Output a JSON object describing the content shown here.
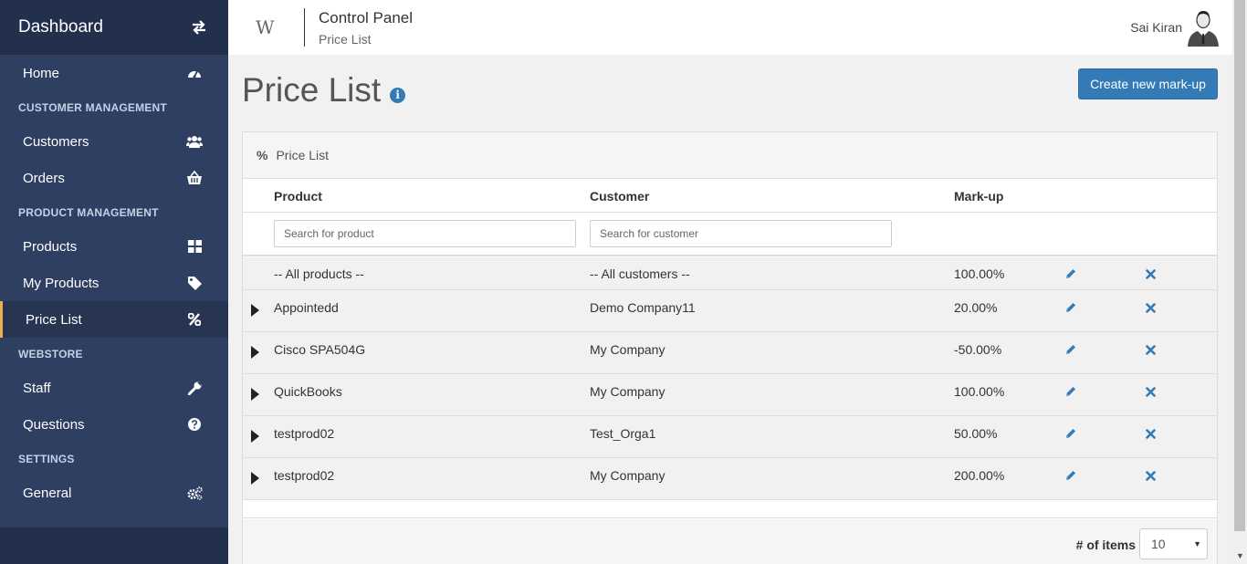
{
  "sidebar": {
    "title": "Dashboard",
    "items": [
      {
        "type": "item",
        "label": "Home",
        "icon": "dashboard-icon"
      },
      {
        "type": "section",
        "label": "CUSTOMER MANAGEMENT"
      },
      {
        "type": "item",
        "label": "Customers",
        "icon": "users-icon"
      },
      {
        "type": "item",
        "label": "Orders",
        "icon": "basket-icon"
      },
      {
        "type": "section",
        "label": "PRODUCT MANAGEMENT"
      },
      {
        "type": "item",
        "label": "Products",
        "icon": "grid-icon"
      },
      {
        "type": "item",
        "label": "My Products",
        "icon": "tag-icon"
      },
      {
        "type": "item",
        "label": "Price List",
        "icon": "percent-icon",
        "active": true
      },
      {
        "type": "section",
        "label": "WEBSTORE"
      },
      {
        "type": "item",
        "label": "Staff",
        "icon": "wrench-icon"
      },
      {
        "type": "item",
        "label": "Questions",
        "icon": "question-icon"
      },
      {
        "type": "section",
        "label": "SETTINGS"
      },
      {
        "type": "item",
        "label": "General",
        "icon": "cogs-icon"
      }
    ]
  },
  "topbar": {
    "logo": "W",
    "title": "Control Panel",
    "subtitle": "Price List",
    "user_name": "Sai Kiran"
  },
  "main": {
    "page_title": "Price List",
    "create_button": "Create new mark-up",
    "panel_title": "Price List",
    "columns": {
      "product": "Product",
      "customer": "Customer",
      "markup": "Mark-up"
    },
    "search_product_placeholder": "Search for product",
    "search_customer_placeholder": "Search for customer",
    "all_row": {
      "product": "-- All products --",
      "customer": "-- All customers --",
      "markup": "100.00%"
    },
    "rows": [
      {
        "product": "Appointedd",
        "customer": "Demo Company11",
        "markup": "20.00%"
      },
      {
        "product": "Cisco SPA504G",
        "customer": "My Company",
        "markup": "-50.00%"
      },
      {
        "product": "QuickBooks",
        "customer": "My Company",
        "markup": "100.00%"
      },
      {
        "product": "testprod02",
        "customer": "Test_Orga1",
        "markup": "50.00%"
      },
      {
        "product": "testprod02",
        "customer": "My Company",
        "markup": "200.00%"
      }
    ],
    "items_label": "# of items",
    "items_value": "10"
  },
  "colors": {
    "sidebar_bg": "#2f3f61",
    "sidebar_header_bg": "#23304d",
    "active_accent": "#f0ad4e",
    "primary": "#337ab7"
  }
}
